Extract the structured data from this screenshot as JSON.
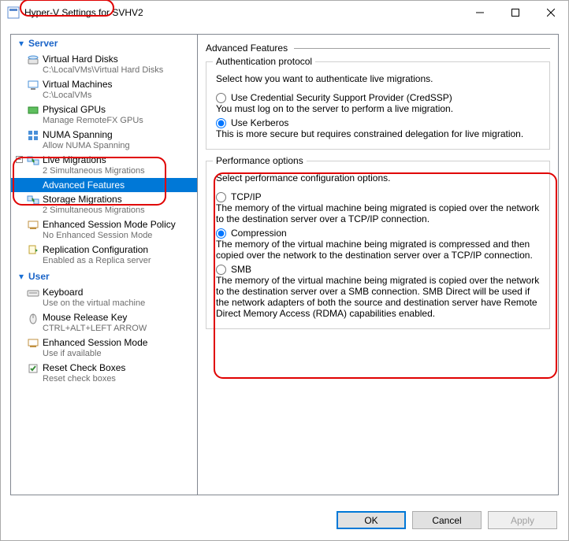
{
  "window": {
    "title": "Hyper-V Settings for SVHV2"
  },
  "winbuttons": {
    "min": "min",
    "max": "max",
    "close": "close"
  },
  "sections": {
    "server": "Server",
    "user": "User"
  },
  "tree": {
    "vhd": {
      "name": "Virtual Hard Disks",
      "desc": "C:\\LocalVMs\\Virtual Hard Disks"
    },
    "vm": {
      "name": "Virtual Machines",
      "desc": "C:\\LocalVMs"
    },
    "gpu": {
      "name": "Physical GPUs",
      "desc": "Manage RemoteFX GPUs"
    },
    "numa": {
      "name": "NUMA Spanning",
      "desc": "Allow NUMA Spanning"
    },
    "lmig": {
      "name": "Live Migrations",
      "desc": "2 Simultaneous Migrations"
    },
    "adv": {
      "name": "Advanced Features"
    },
    "smig": {
      "name": "Storage Migrations",
      "desc": "2 Simultaneous Migrations"
    },
    "esmp": {
      "name": "Enhanced Session Mode Policy",
      "desc": "No Enhanced Session Mode"
    },
    "repl": {
      "name": "Replication Configuration",
      "desc": "Enabled as a Replica server"
    },
    "kbd": {
      "name": "Keyboard",
      "desc": "Use on the virtual machine"
    },
    "mrk": {
      "name": "Mouse Release Key",
      "desc": "CTRL+ALT+LEFT ARROW"
    },
    "esm": {
      "name": "Enhanced Session Mode",
      "desc": "Use if available"
    },
    "reset": {
      "name": "Reset Check Boxes",
      "desc": "Reset check boxes"
    }
  },
  "right": {
    "title": "Advanced Features",
    "auth": {
      "group": "Authentication protocol",
      "desc": "Select how you want to authenticate live migrations.",
      "credssp": {
        "label": "Use Credential Security Support Provider (CredSSP)",
        "desc": "You must log on to the server to perform a live migration."
      },
      "kerberos": {
        "label": "Use Kerberos",
        "desc": "This is more secure but requires constrained delegation for live migration."
      }
    },
    "perf": {
      "group": "Performance options",
      "desc": "Select performance configuration options.",
      "tcp": {
        "label": "TCP/IP",
        "desc": "The memory of the virtual machine being migrated is copied over the network to the destination server over a TCP/IP connection."
      },
      "comp": {
        "label": "Compression",
        "desc": "The memory of the virtual machine being migrated is compressed and then copied over the network to the destination server over a TCP/IP connection."
      },
      "smb": {
        "label": "SMB",
        "desc": "The memory of the virtual machine being migrated is copied over the network to the destination server over a SMB connection. SMB Direct will be used if the network adapters of both the source and destination server have Remote Direct Memory Access (RDMA) capabilities enabled."
      }
    }
  },
  "buttons": {
    "ok": "OK",
    "cancel": "Cancel",
    "apply": "Apply"
  }
}
